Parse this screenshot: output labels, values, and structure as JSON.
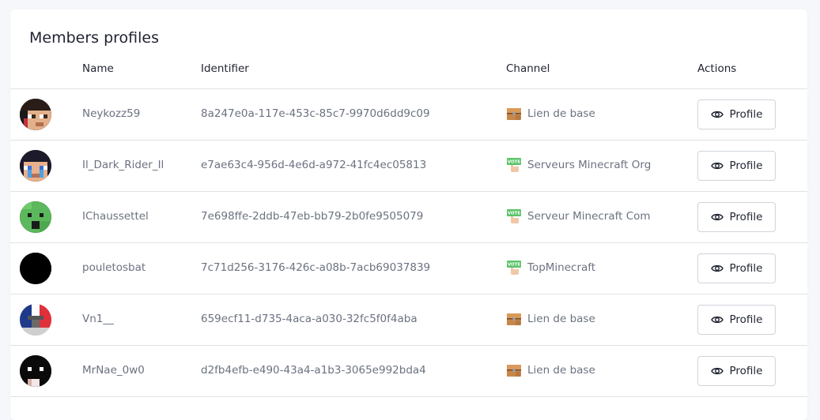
{
  "card": {
    "title": "Members profiles"
  },
  "columns": {
    "name": "Name",
    "identifier": "Identifier",
    "channel": "Channel",
    "actions": "Actions"
  },
  "colors": {
    "text_dark": "#1f2330",
    "text_muted": "#6b7280",
    "border": "#dfe2e6",
    "vote_green": "#5cc46a",
    "chest_brown": "#c8874a"
  },
  "rows": [
    {
      "name": "Neykozz59",
      "identifier": "8a247e0a-117e-453c-85c7-9970d6dd9c09",
      "channel": "Lien de base",
      "channel_icon": "chest-icon",
      "action": "Profile",
      "avatar": "skin-dark-hair"
    },
    {
      "name": "Il_Dark_Rider_Il",
      "identifier": "e7ae63c4-956d-4e6d-a972-41fc4ec05813",
      "channel": "Serveurs Minecraft Org",
      "channel_icon": "vote-icon",
      "action": "Profile",
      "avatar": "skin-blue-eyes"
    },
    {
      "name": "IChaussettel",
      "identifier": "7e698ffe-2ddb-47eb-bb79-2b0fe9505079",
      "channel": "Serveur Minecraft Com",
      "channel_icon": "vote-icon",
      "action": "Profile",
      "avatar": "skin-green-creeper"
    },
    {
      "name": "pouletosbat",
      "identifier": "7c71d256-3176-426c-a08b-7acb69037839",
      "channel": "TopMinecraft",
      "channel_icon": "vote-icon",
      "action": "Profile",
      "avatar": "skin-black"
    },
    {
      "name": "Vn1__",
      "identifier": "659ecf11-d735-4aca-a030-32fc5f0f4aba",
      "channel": "Lien de base",
      "channel_icon": "chest-icon",
      "action": "Profile",
      "avatar": "skin-flag"
    },
    {
      "name": "MrNae_0w0",
      "identifier": "d2fb4efb-e490-43a4-a1b3-3065e992bda4",
      "channel": "Lien de base",
      "channel_icon": "chest-icon",
      "action": "Profile",
      "avatar": "skin-black-hood"
    }
  ]
}
